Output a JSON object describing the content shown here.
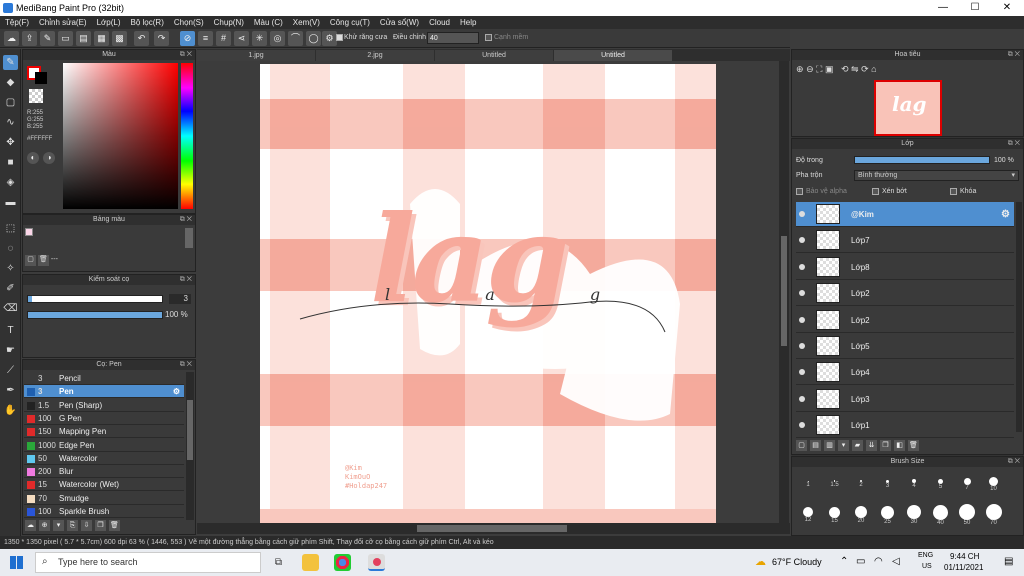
{
  "window": {
    "title": "MediBang Paint Pro (32bit)",
    "min": "—",
    "max": "☐",
    "close": "✕"
  },
  "menu": [
    "Tệp(F)",
    "Chỉnh sửa(E)",
    "Lớp(L)",
    "Bộ lọc(R)",
    "Chọn(S)",
    "Chụp(N)",
    "Màu (C)",
    "Xem(V)",
    "Công cụ(T)",
    "Cửa sổ(W)",
    "Cloud",
    "Help"
  ],
  "toolbar": {
    "antialias_label": "Khử răng cưa",
    "adjust_label": "Điều chỉnh",
    "adjust_value": "40",
    "smooth_label": "Cạnh mềm"
  },
  "color_panel": {
    "title": "Màu",
    "r": "R:255",
    "g": "G:255",
    "b": "B:255",
    "hex": "#FFFFFF"
  },
  "palette_panel": {
    "title": "Bảng màu",
    "footer": "---"
  },
  "brush_control": {
    "title": "Kiểm soát cọ",
    "size": "3",
    "opacity": "100 %",
    "opacity_value": 1.0
  },
  "brush_panel": {
    "title": "Cọ: Pen",
    "items": [
      {
        "size": "3",
        "name": "Pencil",
        "color": "#3a3a3a"
      },
      {
        "size": "3",
        "name": "Pen",
        "color": "#1e5fb0"
      },
      {
        "size": "1.5",
        "name": "Pen (Sharp)",
        "color": "#222222"
      },
      {
        "size": "100",
        "name": "G Pen",
        "color": "#e02a2a"
      },
      {
        "size": "150",
        "name": "Mapping Pen",
        "color": "#e02a2a"
      },
      {
        "size": "1000",
        "name": "Edge Pen",
        "color": "#2aa83a"
      },
      {
        "size": "50",
        "name": "Watercolor",
        "color": "#5fc8f0"
      },
      {
        "size": "200",
        "name": "Blur",
        "color": "#f07ae0"
      },
      {
        "size": "15",
        "name": "Watercolor (Wet)",
        "color": "#e02a2a"
      },
      {
        "size": "70",
        "name": "Smudge",
        "color": "#f5dcc0"
      },
      {
        "size": "100",
        "name": "Sparkle Brush",
        "color": "#2a55d8"
      }
    ]
  },
  "tabs": [
    "1.jpg",
    "2.jpg",
    "Untitled",
    "Untitled"
  ],
  "artwork": {
    "word": "lag",
    "script": "l a g",
    "credit1": "@Kim",
    "credit2": "KimOuO",
    "credit3": "#Holdap247",
    "pink": "#f7a99b"
  },
  "navigator": {
    "title": "Hoa tiêu"
  },
  "layer_panel": {
    "title": "Lớp",
    "opacity_label": "Độ trong",
    "opacity": "100 %",
    "opacity_value": 1.0,
    "blend_label": "Pha trộn",
    "blend_value": "Bình thường",
    "protect_alpha": "Bảo vệ alpha",
    "clipping": "Xén bớt",
    "lock": "Khóa",
    "layers": [
      "@Kim",
      "Lớp7",
      "Lớp8",
      "Lớp2",
      "Lớp2",
      "Lớp5",
      "Lớp4",
      "Lớp3",
      "Lớp1"
    ]
  },
  "brush_size_panel": {
    "title": "Brush Size",
    "row1": [
      "1",
      "1.5",
      "2",
      "3",
      "4",
      "5",
      "7",
      "10"
    ],
    "row2": [
      "12",
      "15",
      "20",
      "25",
      "30",
      "40",
      "50",
      "70"
    ]
  },
  "status": "1350 * 1350 pixel  ( 5.7 * 5.7cm)  600 dpi  63 %  ( 1446, 553 )  Vẽ một đường thẳng bằng cách giữ phím Shift, Thay đổi cỡ cọ bằng cách giữ phím Ctrl, Alt và kéo",
  "taskbar": {
    "search": "Type here to search",
    "weather": "67°F  Cloudy",
    "lang1": "ENG",
    "lang2": "US",
    "time": "9:44 CH",
    "date": "01/11/2021"
  }
}
